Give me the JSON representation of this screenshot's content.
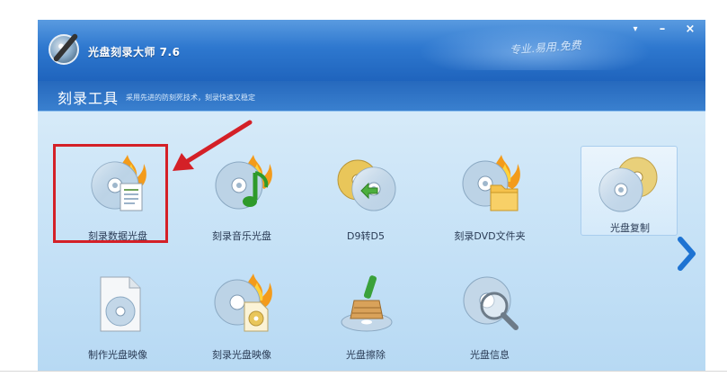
{
  "window": {
    "title": "光盘刻录大师 7.6",
    "slogan": "专业.易用.免费",
    "buttons": {
      "menu": "▾",
      "minimize": "–",
      "close": "×"
    }
  },
  "section": {
    "title": "刻录工具",
    "description": "采用先进的防刻死技术，刻录快速又稳定"
  },
  "tools": [
    {
      "label": "刻录数据光盘",
      "icon": "data-disc-burn-icon",
      "highlighted": true
    },
    {
      "label": "刻录音乐光盘",
      "icon": "music-disc-burn-icon"
    },
    {
      "label": "D9转D5",
      "icon": "d9-to-d5-icon"
    },
    {
      "label": "刻录DVD文件夹",
      "icon": "dvd-folder-burn-icon"
    },
    {
      "label": "光盘复制",
      "icon": "disc-copy-icon",
      "selected": true
    },
    {
      "label": "制作光盘映像",
      "icon": "disc-image-create-icon"
    },
    {
      "label": "刻录光盘映像",
      "icon": "disc-image-burn-icon"
    },
    {
      "label": "光盘擦除",
      "icon": "disc-erase-icon"
    },
    {
      "label": "光盘信息",
      "icon": "disc-info-icon"
    }
  ],
  "colors": {
    "titlebar": "#2e78cf",
    "highlight": "#d42027",
    "next_arrow": "#1e73d2"
  }
}
